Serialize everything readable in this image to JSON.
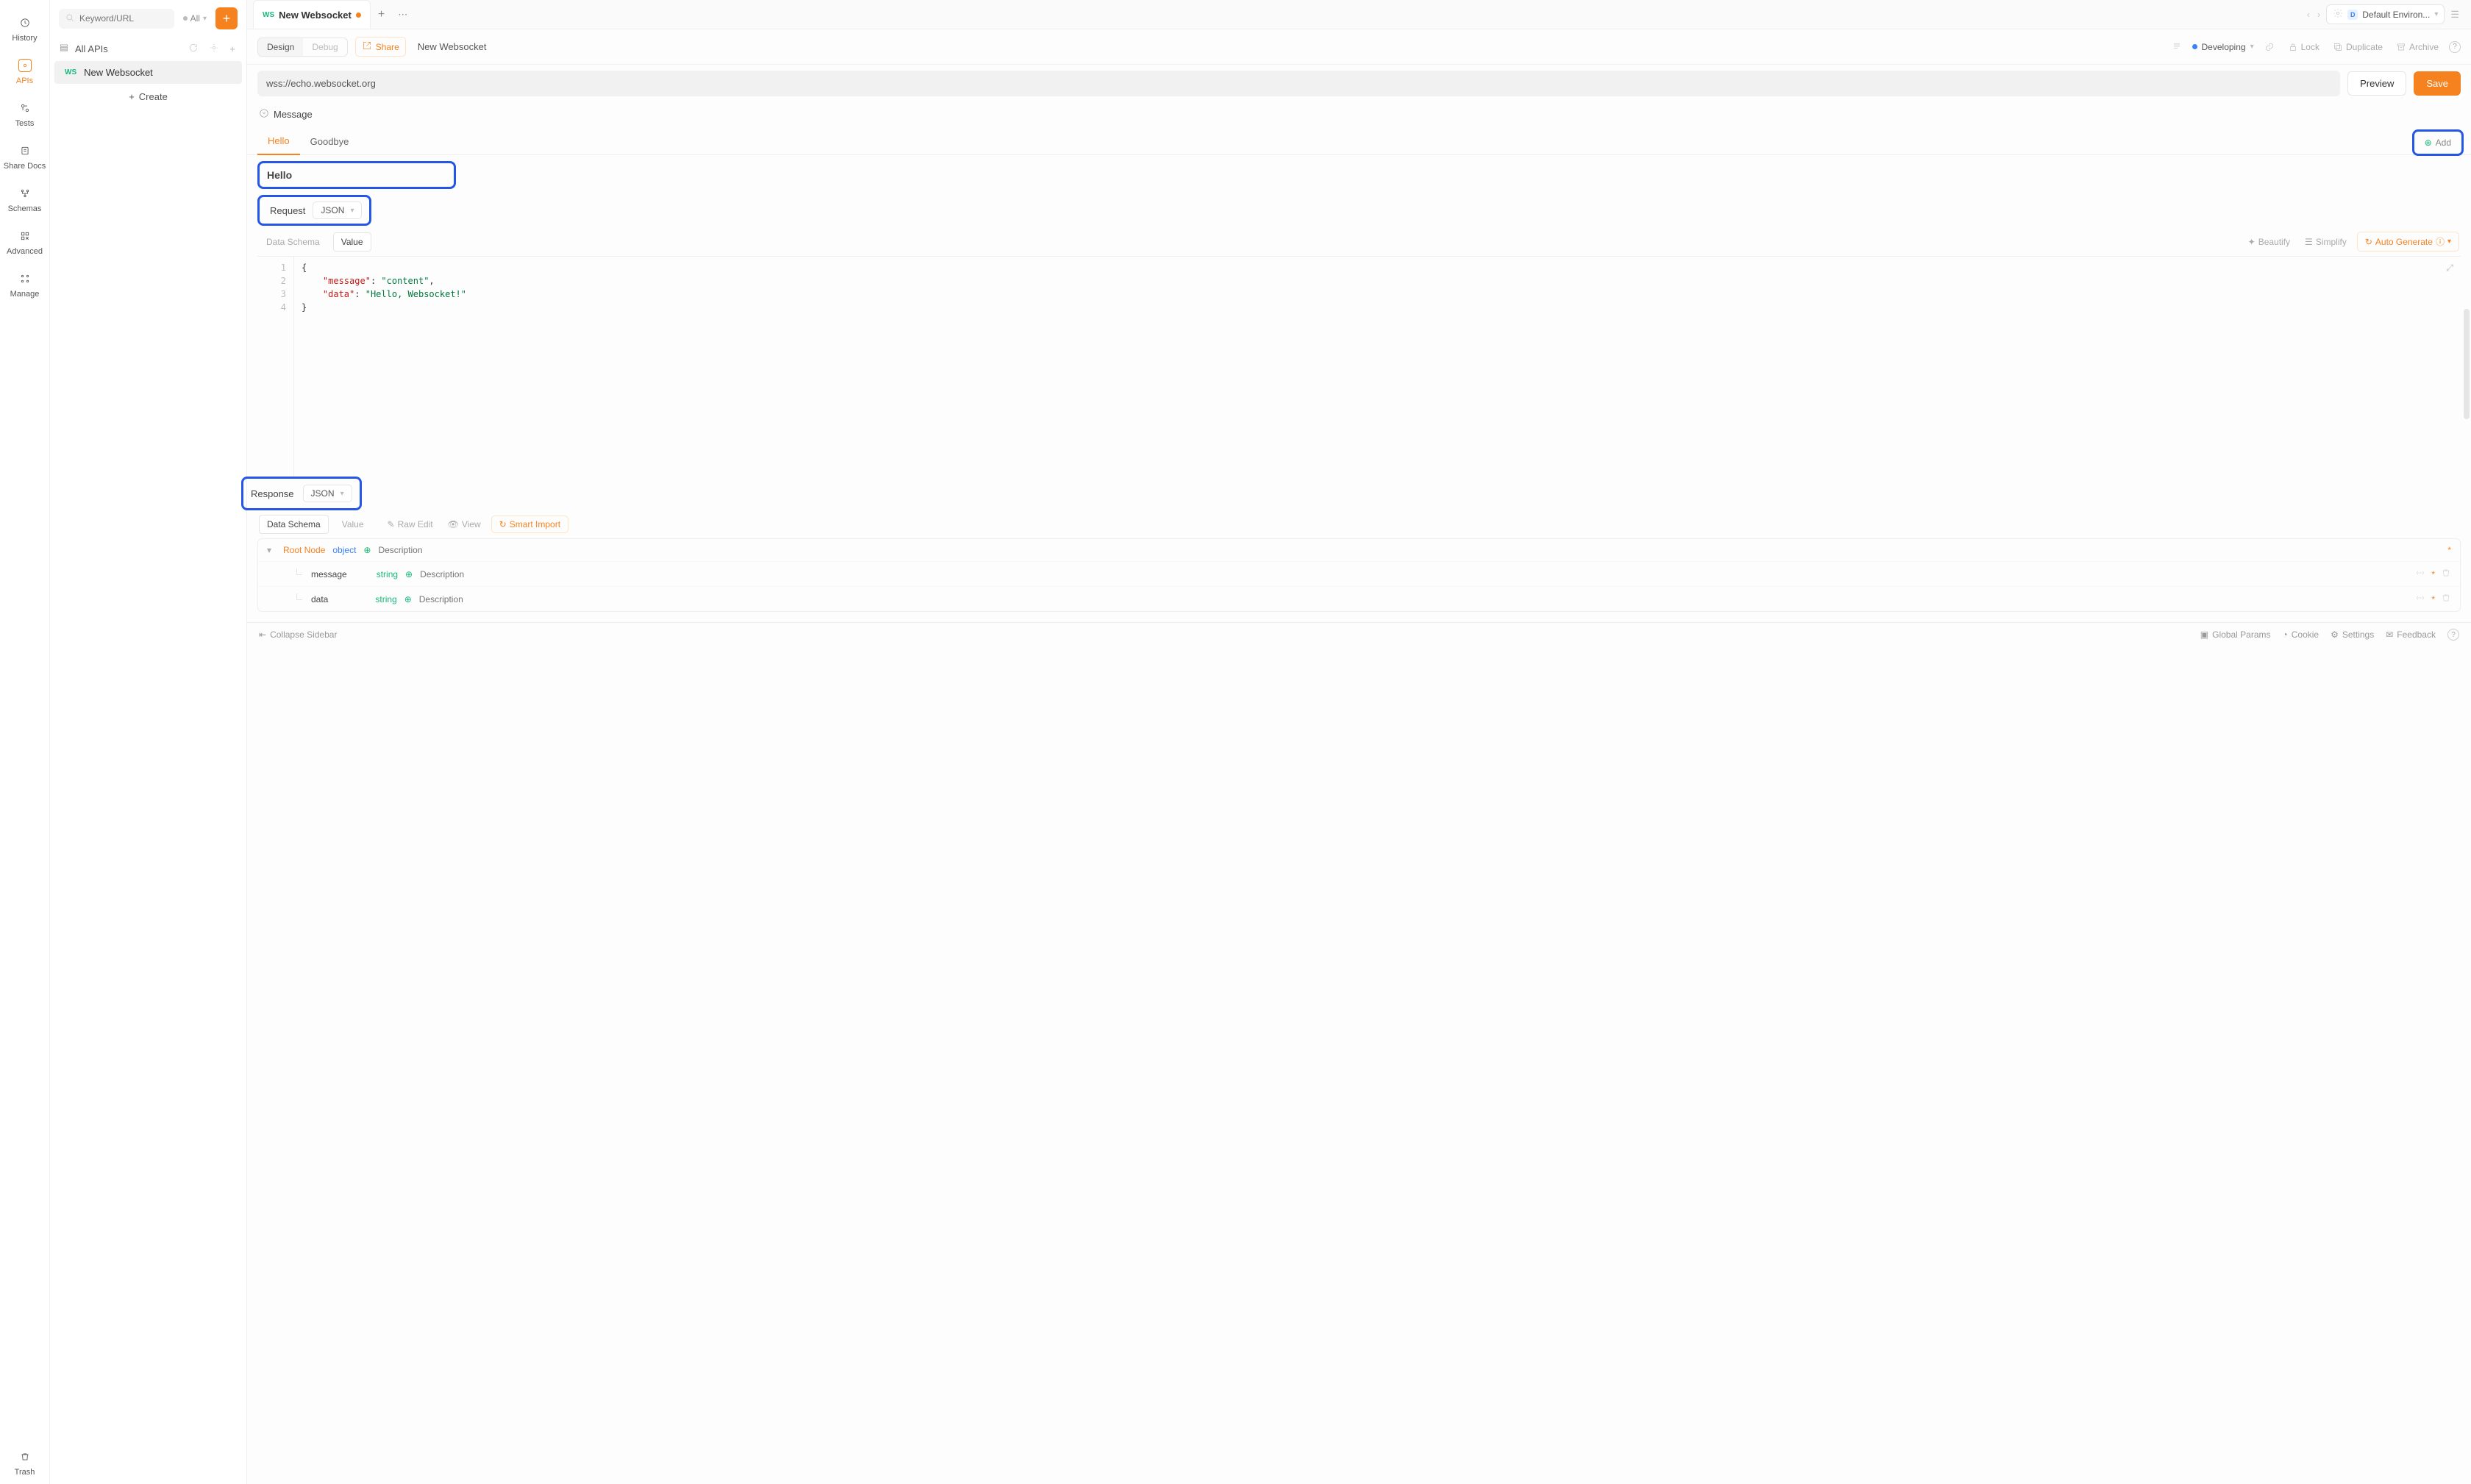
{
  "rail": {
    "history": "History",
    "apis": "APIs",
    "tests": "Tests",
    "share_docs": "Share Docs",
    "schemas": "Schemas",
    "advanced": "Advanced",
    "manage": "Manage",
    "trash": "Trash"
  },
  "sidebar": {
    "search_placeholder": "Keyword/URL",
    "filter_label": "All",
    "section_title": "All APIs",
    "api_badge": "WS",
    "api_name": "New Websocket",
    "create_label": "Create"
  },
  "tabs": {
    "ws_badge": "WS",
    "title": "New Websocket"
  },
  "env": {
    "label": "Default Environ..."
  },
  "actions": {
    "design": "Design",
    "debug": "Debug",
    "share": "Share",
    "breadcrumb": "New Websocket",
    "status": "Developing",
    "lock": "Lock",
    "duplicate": "Duplicate",
    "archive": "Archive"
  },
  "url": {
    "value": "wss://echo.websocket.org",
    "preview": "Preview",
    "save": "Save"
  },
  "message": {
    "section": "Message",
    "tabs": [
      "Hello",
      "Goodbye"
    ],
    "add": "Add",
    "name_value": "Hello",
    "request_label": "Request",
    "request_type": "JSON",
    "ed_tabs": {
      "schema": "Data Schema",
      "value": "Value"
    },
    "toolbar": {
      "beautify": "Beautify",
      "simplify": "Simplify",
      "autogen": "Auto Generate"
    },
    "code": {
      "lines": [
        {
          "n": 1,
          "t": "brace",
          "txt": "{"
        },
        {
          "n": 2,
          "t": "kv",
          "key": "\"message\"",
          "val": "\"content\"",
          "comma": ","
        },
        {
          "n": 3,
          "t": "kv",
          "key": "\"data\"",
          "val": "\"Hello, Websocket!\"",
          "comma": ""
        },
        {
          "n": 4,
          "t": "brace",
          "txt": "}"
        }
      ]
    }
  },
  "response": {
    "label": "Response",
    "type": "JSON",
    "ed_tabs": {
      "schema": "Data Schema",
      "value": "Value"
    },
    "toolbar": {
      "rawedit": "Raw Edit",
      "view": "View",
      "smartimport": "Smart Import"
    },
    "root": {
      "name": "Root Node",
      "type": "object",
      "desc_ph": "Description"
    },
    "fields": [
      {
        "name": "message",
        "type": "string",
        "desc_ph": "Description"
      },
      {
        "name": "data",
        "type": "string",
        "desc_ph": "Description"
      }
    ]
  },
  "footer": {
    "collapse": "Collapse Sidebar",
    "global": "Global Params",
    "cookie": "Cookie",
    "settings": "Settings",
    "feedback": "Feedback"
  }
}
